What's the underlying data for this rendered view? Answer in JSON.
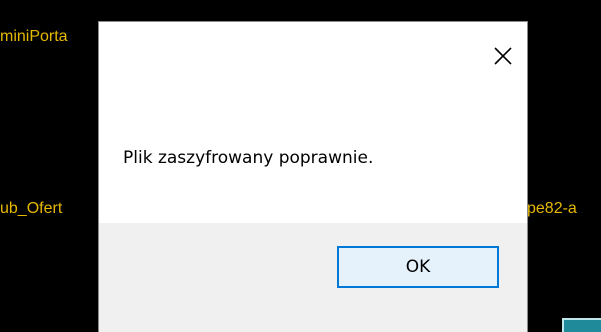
{
  "background": {
    "left_top_text": "miniPorta",
    "left_mid_text": "ub_Ofert",
    "right_mid_text": "pe82-a",
    "text_color": "#e6b800",
    "teal_color": "#1f8a99"
  },
  "dialog": {
    "message": "Plik zaszyfrowany poprawnie.",
    "ok_label": "OK",
    "close_icon": "close-icon",
    "accent_color": "#0078d7"
  }
}
